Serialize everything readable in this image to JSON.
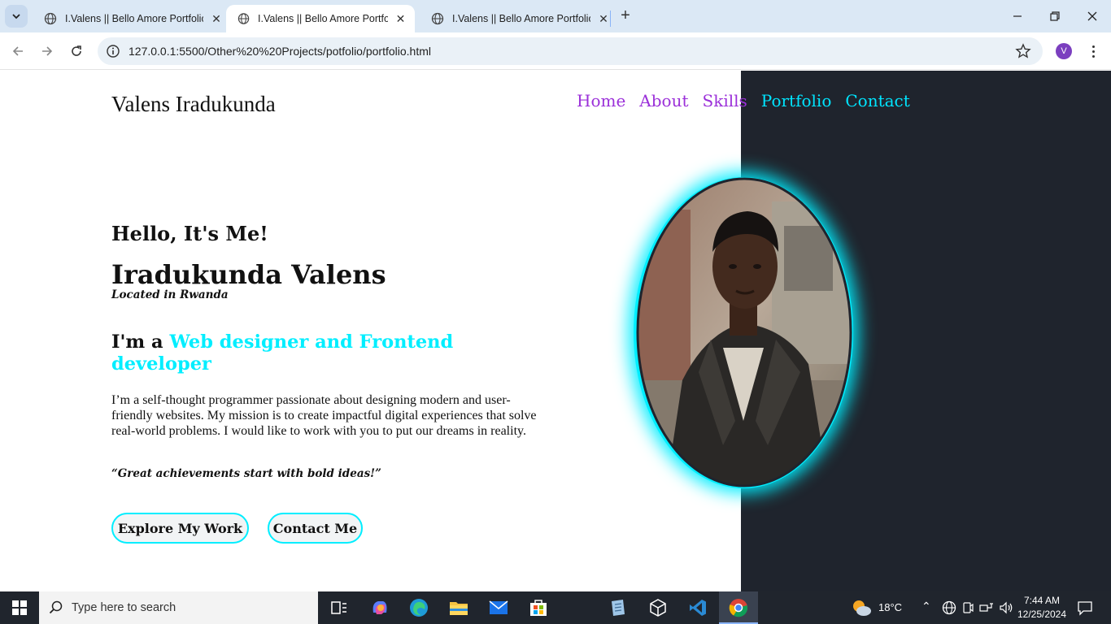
{
  "browser": {
    "tabs": [
      {
        "title": "I.Valens || Bello Amore Portfolio",
        "active": false
      },
      {
        "title": "I.Valens || Bello Amore Portfolio",
        "active": true
      },
      {
        "title": "I.Valens || Bello Amore Portfolio",
        "active": false
      }
    ],
    "url": "127.0.0.1:5500/Other%20%20Projects/potfolio/portfolio.html",
    "profile_initial": "V"
  },
  "page": {
    "logo": "Valens Iradukunda",
    "nav": [
      {
        "label": "Home",
        "color": "#9b30d9"
      },
      {
        "label": "About",
        "color": "#9b30d9"
      },
      {
        "label": "Skills",
        "color": "#9b30d9"
      },
      {
        "label": "Portfolio",
        "color": "#00e5ff"
      },
      {
        "label": "Contact",
        "color": "#00e5ff"
      }
    ],
    "greeting": "Hello, It's Me!",
    "name": "Iradukunda Valens",
    "location": "Located in Rwanda",
    "role_prefix": "I'm a",
    "role_highlight": "Web designer and Frontend developer",
    "bio": "I’m a self-thought programmer passionate about designing modern and user-friendly websites. My mission is to create impactful digital experiences that solve real-world problems. I would like to work with you to put our dreams in reality.",
    "quote": "“Great achievements start with bold ideas!”",
    "buttons": {
      "explore": "Explore My Work",
      "contact": "Contact Me"
    },
    "accent_color": "#00eeff",
    "dark_panel_color": "#1f242d"
  },
  "taskbar": {
    "search_placeholder": "Type here to search",
    "weather": "18°C",
    "time": "7:44 AM",
    "date": "12/25/2024"
  }
}
